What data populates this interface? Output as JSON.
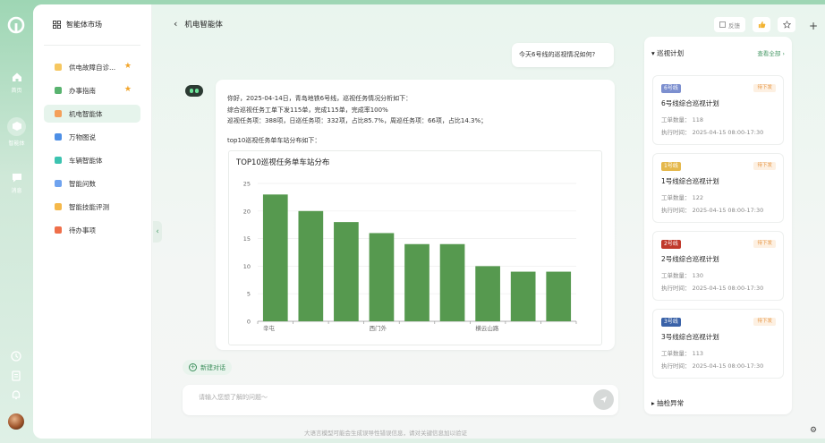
{
  "rail": {
    "items": [
      {
        "label": "首页"
      },
      {
        "label": "智能体"
      },
      {
        "label": "消息"
      }
    ]
  },
  "sidebar": {
    "title": "智能体市场",
    "items": [
      {
        "label": "供电故障自诊...",
        "color": "#f6c760",
        "starred": true
      },
      {
        "label": "办事指南",
        "color": "#59b36f",
        "starred": true
      },
      {
        "label": "机电智能体",
        "color": "#f4a05a",
        "starred": false,
        "active": true
      },
      {
        "label": "万物图说",
        "color": "#4d8fe6",
        "starred": false
      },
      {
        "label": "车辆智能体",
        "color": "#3cc3b0",
        "starred": false
      },
      {
        "label": "智能问数",
        "color": "#6fa3ef",
        "starred": false
      },
      {
        "label": "智能技能评测",
        "color": "#f5b84a",
        "starred": false
      },
      {
        "label": "待办事项",
        "color": "#ef6f4a",
        "starred": false
      }
    ]
  },
  "header": {
    "title": "机电智能体",
    "feedback": "反馈"
  },
  "chat": {
    "user_message": "今天6号线的巡视情况如何?",
    "bot_lines": [
      "你好，2025-04-14日，青岛地铁6号线，巡视任务情况分析如下：",
      "综合巡视任务工单下发115单，完成115单，完成率100%",
      "巡视任务项：388项，日巡任务项：332项，占比85.7%，周巡任务项：66项，占比14.3%；"
    ],
    "bot_subtitle": "top10巡视任务单车站分布如下："
  },
  "chart_data": {
    "type": "bar",
    "title": "TOP10巡视任务单车站分布",
    "categories": [
      "辛屯",
      "",
      "",
      "西门外",
      "",
      "",
      "横云山路",
      "",
      ""
    ],
    "values": [
      23,
      20,
      18,
      16,
      14,
      14,
      10,
      9,
      9
    ],
    "ylim": [
      0,
      25
    ],
    "yticks": [
      0,
      5,
      10,
      15,
      20,
      25
    ],
    "bar_color": "#56994f",
    "grid": true
  },
  "composer": {
    "new_chat": "新建对话",
    "placeholder": "请输入您想了解的问题～",
    "disclaimer": "大语言模型可能会生成误导性错误信息，请对关键信息加以验证"
  },
  "plans": {
    "title": "巡视计划",
    "more": "查看全部",
    "items": [
      {
        "tag": "6号线",
        "tag_color": "#7c8fcf",
        "status": "待下发",
        "name": "6号线综合巡视计划",
        "count_label": "工单数量：",
        "count": "118",
        "time_label": "执行时间：",
        "time": "2025-04-15 08:00-17:30"
      },
      {
        "tag": "1号线",
        "tag_color": "#e5b84c",
        "status": "待下发",
        "name": "1号线综合巡视计划",
        "count_label": "工单数量：",
        "count": "122",
        "time_label": "执行时间：",
        "time": "2025-04-15 08:00-17:30"
      },
      {
        "tag": "2号线",
        "tag_color": "#c0392b",
        "status": "待下发",
        "name": "2号线综合巡视计划",
        "count_label": "工单数量：",
        "count": "130",
        "time_label": "执行时间：",
        "time": "2025-04-15 08:00-17:30"
      },
      {
        "tag": "3号线",
        "tag_color": "#3a62a8",
        "status": "待下发",
        "name": "3号线综合巡视计划",
        "count_label": "工单数量：",
        "count": "113",
        "time_label": "执行时间：",
        "time": "2025-04-15 08:00-17:30"
      }
    ],
    "footer": "抽检异常"
  }
}
